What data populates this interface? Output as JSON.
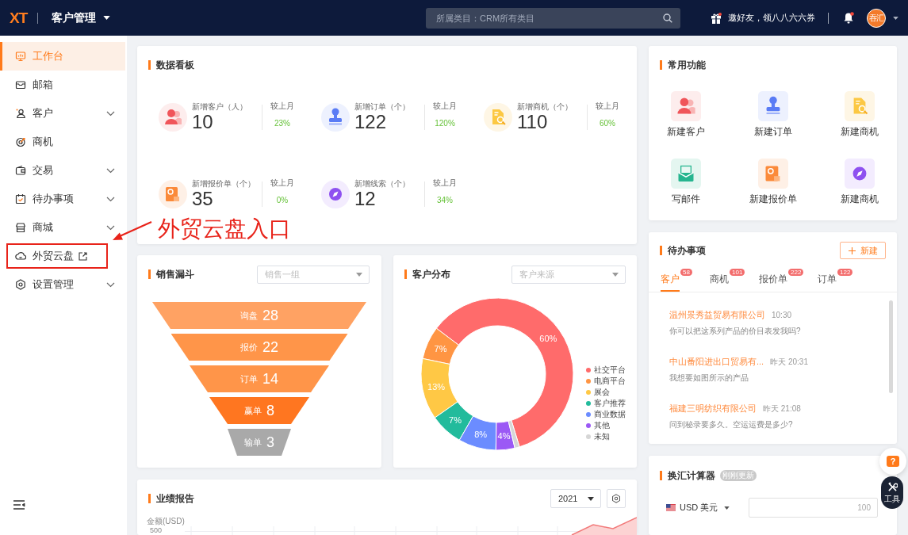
{
  "top_bar": {
    "logo": "XT",
    "module_menu": "客户管理",
    "search": {
      "placeholder": "所属类目：CRM所有类目"
    },
    "invite": "邀好友，领八八六六券",
    "notifications": {
      "unread": true
    },
    "avatar": "吞汇"
  },
  "sidebar": {
    "items": [
      {
        "label": "工作台",
        "selected": true,
        "expandable": false,
        "external": false,
        "highlighted": false
      },
      {
        "label": "邮箱",
        "selected": false,
        "expandable": false,
        "external": false,
        "highlighted": false
      },
      {
        "label": "客户",
        "selected": false,
        "expandable": true,
        "external": false,
        "highlighted": false
      },
      {
        "label": "商机",
        "selected": false,
        "expandable": false,
        "external": false,
        "highlighted": false
      },
      {
        "label": "交易",
        "selected": false,
        "expandable": true,
        "external": false,
        "highlighted": false
      },
      {
        "label": "待办事项",
        "selected": false,
        "expandable": true,
        "external": false,
        "highlighted": false
      },
      {
        "label": "商城",
        "selected": false,
        "expandable": true,
        "external": false,
        "highlighted": false
      },
      {
        "label": "外贸云盘",
        "selected": false,
        "expandable": false,
        "external": true,
        "highlighted": true
      },
      {
        "label": "设置管理",
        "selected": false,
        "expandable": true,
        "external": false,
        "highlighted": false
      }
    ]
  },
  "annotation": {
    "text": "外贸云盘入口"
  },
  "data_board": {
    "title": "数据看板",
    "stats": [
      {
        "label": "新增客户（人）",
        "value": "10",
        "compare_label": "较上月",
        "change": "23%"
      },
      {
        "label": "新增订单（个）",
        "value": "122",
        "compare_label": "较上月",
        "change": "120%"
      },
      {
        "label": "新增商机（个）",
        "value": "110",
        "compare_label": "较上月",
        "change": "60%"
      },
      {
        "label": "新增报价单（个）",
        "value": "35",
        "compare_label": "较上月",
        "change": "0%"
      },
      {
        "label": "新增线索（个）",
        "value": "12",
        "compare_label": "较上月",
        "change": "34%"
      }
    ]
  },
  "funnel": {
    "title": "销售漏斗",
    "select": {
      "placeholder": "销售一组"
    },
    "stages": [
      {
        "label": "询盘",
        "value": "28",
        "color": "#ffa263"
      },
      {
        "label": "报价",
        "value": "22",
        "color": "#ff9549"
      },
      {
        "label": "订单",
        "value": "14",
        "color": "#ff9549"
      },
      {
        "label": "赢单",
        "value": "8",
        "color": "#ff7620"
      },
      {
        "label": "输单",
        "value": "3",
        "color": "#a9a9a9"
      }
    ]
  },
  "customer_distribution": {
    "title": "客户分布",
    "select": {
      "placeholder": "客户来源"
    },
    "chart_data": {
      "type": "donut",
      "categories": [
        "社交平台",
        "电商平台",
        "展会",
        "客户推荐",
        "商业数据",
        "其他",
        "未知"
      ],
      "values": [
        60,
        7,
        13,
        7,
        8,
        4,
        1
      ],
      "colors": [
        "#ff6b6b",
        "#ff9543",
        "#ffc845",
        "#22bb9c",
        "#6b8cff",
        "#9b59f5",
        "#d6d6d6"
      ],
      "value_labels": [
        "60%",
        "7%",
        "13%",
        "7%",
        "8%",
        "4%",
        null
      ],
      "legend": "right"
    }
  },
  "performance": {
    "title": "业绩报告",
    "year_select": {
      "value": "2021"
    },
    "axis_title": "金额(USD)",
    "axis_tick": "500"
  },
  "quick_actions": {
    "title": "常用功能",
    "items": [
      {
        "label": "新建客户"
      },
      {
        "label": "新建订单"
      },
      {
        "label": "新建商机"
      },
      {
        "label": "写邮件"
      },
      {
        "label": "新建报价单"
      },
      {
        "label": "新建商机"
      }
    ]
  },
  "todo": {
    "title": "待办事项",
    "new_button": "新建",
    "tabs": [
      {
        "label": "客户",
        "badge": "58",
        "selected": true
      },
      {
        "label": "商机",
        "badge": "101",
        "selected": false
      },
      {
        "label": "报价单",
        "badge": "222",
        "selected": false
      },
      {
        "label": "订单",
        "badge": "122",
        "selected": false
      }
    ],
    "messages": [
      {
        "company": "温州景秀益贸易有限公司",
        "time": "10:30",
        "text": "你可以把这系列产品的价目表发我吗?"
      },
      {
        "company": "中山番阳进出口贸易有...",
        "time": "昨天 20:31",
        "text": "我想要如图所示的产品"
      },
      {
        "company": "福建三明纺织有限公司",
        "time": "昨天 21:08",
        "text": "问到秘录要多久。空运运费是多少?"
      }
    ]
  },
  "exchange": {
    "title": "换汇计算器",
    "status": "刚刚更新",
    "rows": [
      {
        "currency": "USD 美元",
        "amount": "100"
      }
    ]
  },
  "floating": {
    "help": "?",
    "tools": "工具"
  }
}
